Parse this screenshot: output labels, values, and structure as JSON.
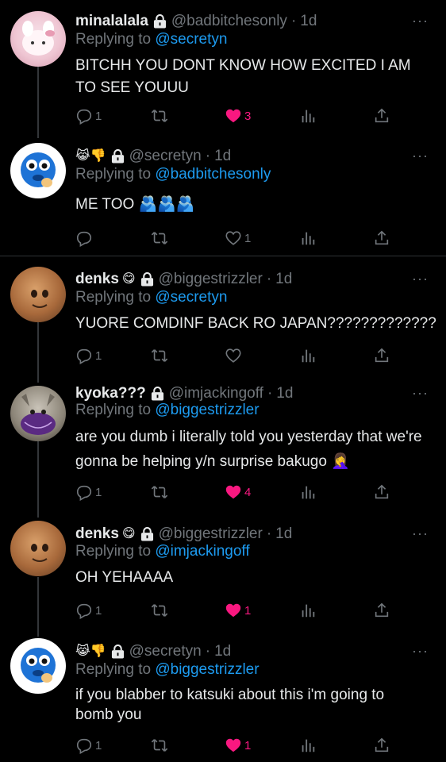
{
  "tweets": [
    {
      "name": "minalalala",
      "handle": "@badbitchesonly",
      "sep": "·",
      "time": "1d",
      "reply_prefix": "Replying to",
      "reply_to": "@secretyn",
      "text": "BITCHH YOU DONT KNOW HOW EXCITED I AM TO SEE YOUUU",
      "replies": "1",
      "retweets": "",
      "likes": "3",
      "liked": true
    },
    {
      "name": "",
      "name_emojis": "😹👎",
      "handle": "@secretyn",
      "sep": "·",
      "time": "1d",
      "reply_prefix": "Replying to",
      "reply_to": "@badbitchesonly",
      "text": "ME TOO 🫂🫂🫂",
      "replies": "",
      "retweets": "",
      "likes": "1",
      "liked": false
    },
    {
      "name": "denks",
      "name_emojis": "😋",
      "handle": "@biggestrizzler",
      "sep": "·",
      "time": "1d",
      "reply_prefix": "Replying to",
      "reply_to": "@secretyn",
      "text": "YUORE COMDINF BACK RO JAPAN?????????????",
      "replies": "1",
      "retweets": "",
      "likes": "",
      "liked": false
    },
    {
      "name": "kyoka???",
      "handle": "@imjackingoff",
      "sep": "·",
      "time": "1d",
      "reply_prefix": "Replying to",
      "reply_to": "@biggestrizzler",
      "text": "are you dumb i literally told you yesterday that we're gonna be helping y/n surprise bakugo 🤦‍♀️",
      "replies": "1",
      "retweets": "",
      "likes": "4",
      "liked": true
    },
    {
      "name": "denks",
      "name_emojis": "😋",
      "handle": "@biggestrizzler",
      "sep": "·",
      "time": "1d",
      "reply_prefix": "Replying to",
      "reply_to": "@imjackingoff",
      "text": "OH YEHAAAA",
      "replies": "1",
      "retweets": "",
      "likes": "1",
      "liked": true
    },
    {
      "name": "",
      "name_emojis": "😹👎",
      "handle": "@secretyn",
      "sep": "·",
      "time": "1d",
      "reply_prefix": "Replying to",
      "reply_to": "@biggestrizzler",
      "text": "if you blabber to katsuki about this i'm going to bomb you",
      "replies": "1",
      "retweets": "",
      "likes": "1",
      "liked": true
    }
  ],
  "colors": {
    "accent": "#1d9bf0",
    "like": "#f91880",
    "muted": "#71767b",
    "bg": "#000000"
  }
}
